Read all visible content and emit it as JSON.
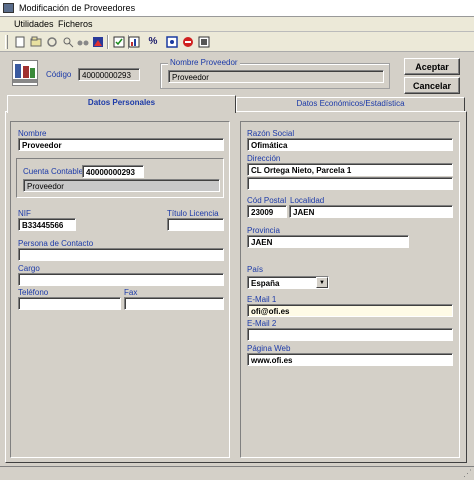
{
  "window": {
    "title": "Modificación de Proveedores"
  },
  "menu": [
    {
      "label": "Utilidades"
    },
    {
      "label": "Ficheros"
    }
  ],
  "toolbar": {
    "icons": [
      "new-icon",
      "open-icon",
      "undo-icon",
      "find-icon",
      "binoculars-icon",
      "image-icon",
      "calendar-check-icon",
      "chart-icon",
      "percent-icon",
      "settings-icon",
      "help-icon",
      "stop-icon",
      "print-icon"
    ]
  },
  "header": {
    "codigo_label": "Código",
    "codigo_value": "40000000293",
    "nombre_proveedor_label": "Nombre Proveedor",
    "nombre_proveedor_value": "Proveedor",
    "aceptar_label": "Aceptar",
    "cancelar_label": "Cancelar"
  },
  "tabs": [
    {
      "label": "Datos Personales",
      "active": true
    },
    {
      "label": "Datos Económicos/Estadística",
      "active": false
    }
  ],
  "left": {
    "nombre_label": "Nombre",
    "nombre_value": "Proveedor",
    "cuenta_contable_label": "Cuenta Contable",
    "cuenta_contable_value": "40000000293",
    "cuenta_contable_desc": "Proveedor",
    "nif_label": "NIF",
    "nif_value": "B33445566",
    "titulo_licencia_label": "Título Licencia",
    "titulo_licencia_value": "",
    "persona_contacto_label": "Persona de Contacto",
    "persona_contacto_value": "",
    "cargo_label": "Cargo",
    "cargo_value": "",
    "telefono_label": "Teléfono",
    "telefono_value": "",
    "fax_label": "Fax",
    "fax_value": ""
  },
  "right": {
    "razon_social_label": "Razón Social",
    "razon_social_value": "Ofimática",
    "direccion_label": "Dirección",
    "direccion_value": "CL Ortega Nieto, Parcela 1",
    "direccion_value2": "",
    "cod_postal_label": "Cód Postal",
    "cod_postal_value": "23009",
    "localidad_label": "Localidad",
    "localidad_value": "JAEN",
    "provincia_label": "Provincia",
    "provincia_value": "JAEN",
    "pais_label": "País",
    "pais_value": "España",
    "email1_label": "E-Mail 1",
    "email1_value": "ofi@ofi.es",
    "email2_label": "E-Mail 2",
    "email2_value": "",
    "web_label": "Página Web",
    "web_value": "www.ofi.es"
  }
}
